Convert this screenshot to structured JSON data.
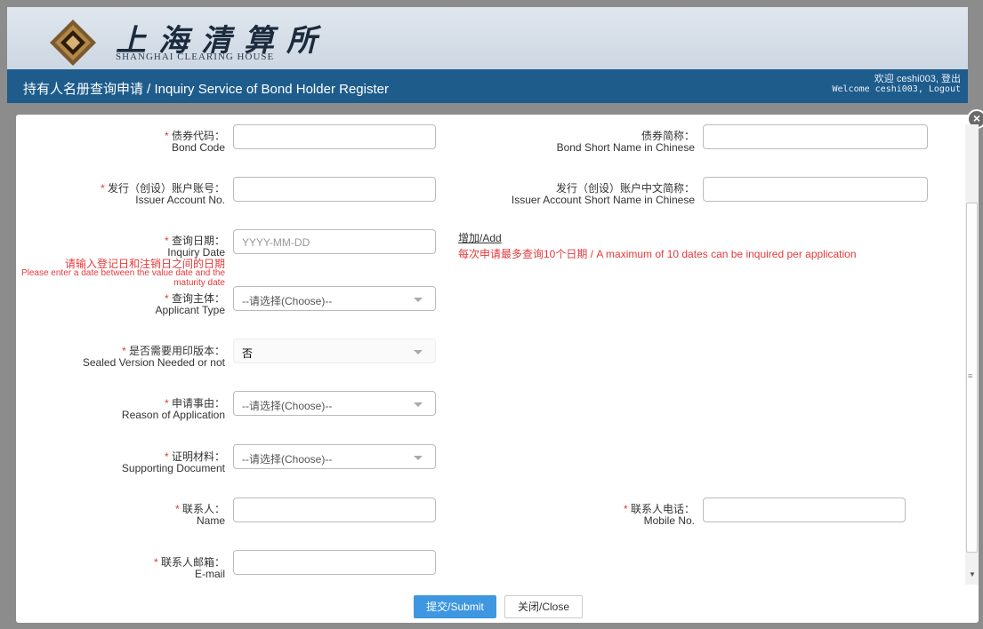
{
  "header": {
    "logo_cn": "上海清算所",
    "logo_en": "SHANGHAI CLEARING HOUSE"
  },
  "titlebar": {
    "title": "持有人名册查询申请 / Inquiry Service of Bond Holder Register",
    "welcome_cn": "欢迎 ceshi003, 登出",
    "welcome_en": "Welcome ceshi003, Logout"
  },
  "form": {
    "required_mark": "*",
    "bond_code": {
      "cn": "债券代码：",
      "en": "Bond Code"
    },
    "bond_short_name": {
      "cn": "债券简称：",
      "en": "Bond Short Name in Chinese"
    },
    "issuer_account": {
      "cn": "发行（创设）账户账号：",
      "en": "Issuer Account No."
    },
    "issuer_account_short": {
      "cn": "发行（创设）账户中文简称：",
      "en": "Issuer Account Short Name in Chinese"
    },
    "inquiry_date": {
      "cn": "查询日期：",
      "en": "Inquiry Date",
      "placeholder": "YYYY-MM-DD",
      "note_cn": "请输入登记日和注销日之间的日期",
      "note_en": "Please enter a date between the value date and the maturity date"
    },
    "add_link": "增加/Add",
    "max_note": "每次申请最多查询10个日期 / A maximum of 10 dates can be inquired per application",
    "applicant_type": {
      "cn": "查询主体：",
      "en": "Applicant Type",
      "value": "--请选择(Choose)--"
    },
    "sealed_version": {
      "cn": "是否需要用印版本：",
      "en": "Sealed Version Needed or not",
      "value": "否"
    },
    "reason": {
      "cn": "申请事由：",
      "en": "Reason of Application",
      "value": "--请选择(Choose)--"
    },
    "supporting_doc": {
      "cn": "证明材料：",
      "en": "Supporting Document",
      "value": "--请选择(Choose)--"
    },
    "contact_name": {
      "cn": "联系人：",
      "en": "Name"
    },
    "contact_phone": {
      "cn": "联系人电话：",
      "en": "Mobile No."
    },
    "contact_email": {
      "cn": "联系人邮箱：",
      "en": "E-mail"
    }
  },
  "buttons": {
    "submit": "提交/Submit",
    "close": "关闭/Close"
  },
  "icons": {
    "close": "×",
    "scroll_grip": "≡",
    "scroll_down": "▼"
  },
  "colors": {
    "title_bar": "#1e5c8c",
    "required": "#e4393c",
    "submit": "#3e97e0"
  }
}
